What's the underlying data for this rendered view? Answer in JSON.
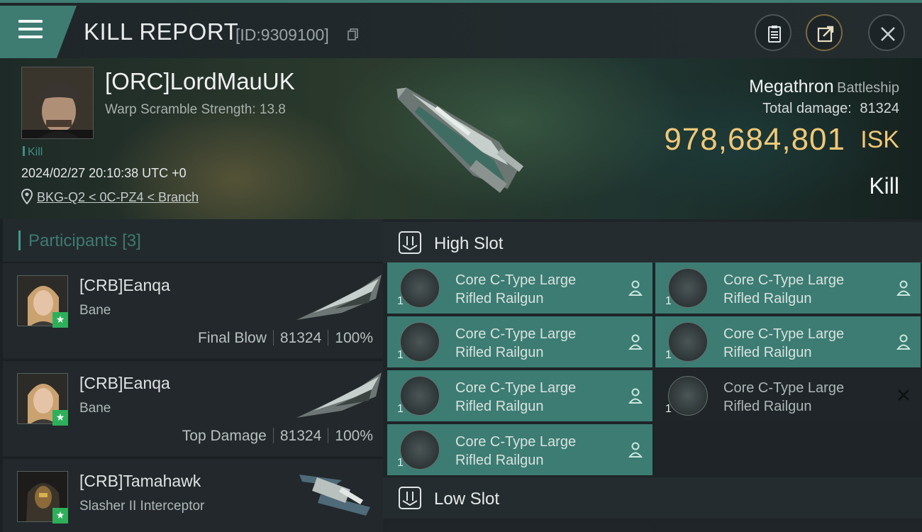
{
  "header": {
    "title": "KILL REPORT",
    "report_id": "[ID:9309100]"
  },
  "victim": {
    "name": "[ORC]LordMauUK",
    "warp_scramble": "Warp Scramble Strength: 13.8",
    "tag": "Kill",
    "timestamp": "2024/02/27 20:10:38 UTC +0",
    "location": "BKG-Q2 < 0C-PZ4 < Branch"
  },
  "ship": {
    "name": "Megathron",
    "class": "Battleship",
    "total_damage_label": "Total damage:",
    "total_damage": "81324",
    "isk_value": "978,684,801",
    "isk_unit": "ISK",
    "result": "Kill"
  },
  "participants": {
    "title": "Participants",
    "count": "[3]",
    "rows": [
      {
        "name": "[CRB]Eanqa",
        "ship": "Bane",
        "role": "Final Blow",
        "damage": "81324",
        "percent": "100%"
      },
      {
        "name": "[CRB]Eanqa",
        "ship": "Bane",
        "role": "Top Damage",
        "damage": "81324",
        "percent": "100%"
      },
      {
        "name": "[CRB]Tamahawk",
        "ship": "Slasher II Interceptor",
        "role": "",
        "damage": "",
        "percent": ""
      }
    ]
  },
  "slots": {
    "high_label": "High Slot",
    "low_label": "Low Slot",
    "high": [
      {
        "line1": "Core C-Type Large",
        "line2": "Rifled Railgun",
        "qty": "1",
        "status": "dropped"
      },
      {
        "line1": "Core C-Type Large",
        "line2": "Rifled Railgun",
        "qty": "1",
        "status": "dropped"
      },
      {
        "line1": "Core C-Type Large",
        "line2": "Rifled Railgun",
        "qty": "1",
        "status": "dropped"
      },
      {
        "line1": "Core C-Type Large",
        "line2": "Rifled Railgun",
        "qty": "1",
        "status": "dropped"
      },
      {
        "line1": "Core C-Type Large",
        "line2": "Rifled Railgun",
        "qty": "1",
        "status": "dropped"
      },
      {
        "line1": "Core C-Type Large",
        "line2": "Rifled Railgun",
        "qty": "1",
        "status": "destroyed"
      },
      {
        "line1": "Core C-Type Large",
        "line2": "Rifled Railgun",
        "qty": "1",
        "status": "dropped"
      }
    ]
  },
  "colors": {
    "accent": "#3e7c72",
    "isk": "#f0c878",
    "badge": "#2eaf5a"
  }
}
